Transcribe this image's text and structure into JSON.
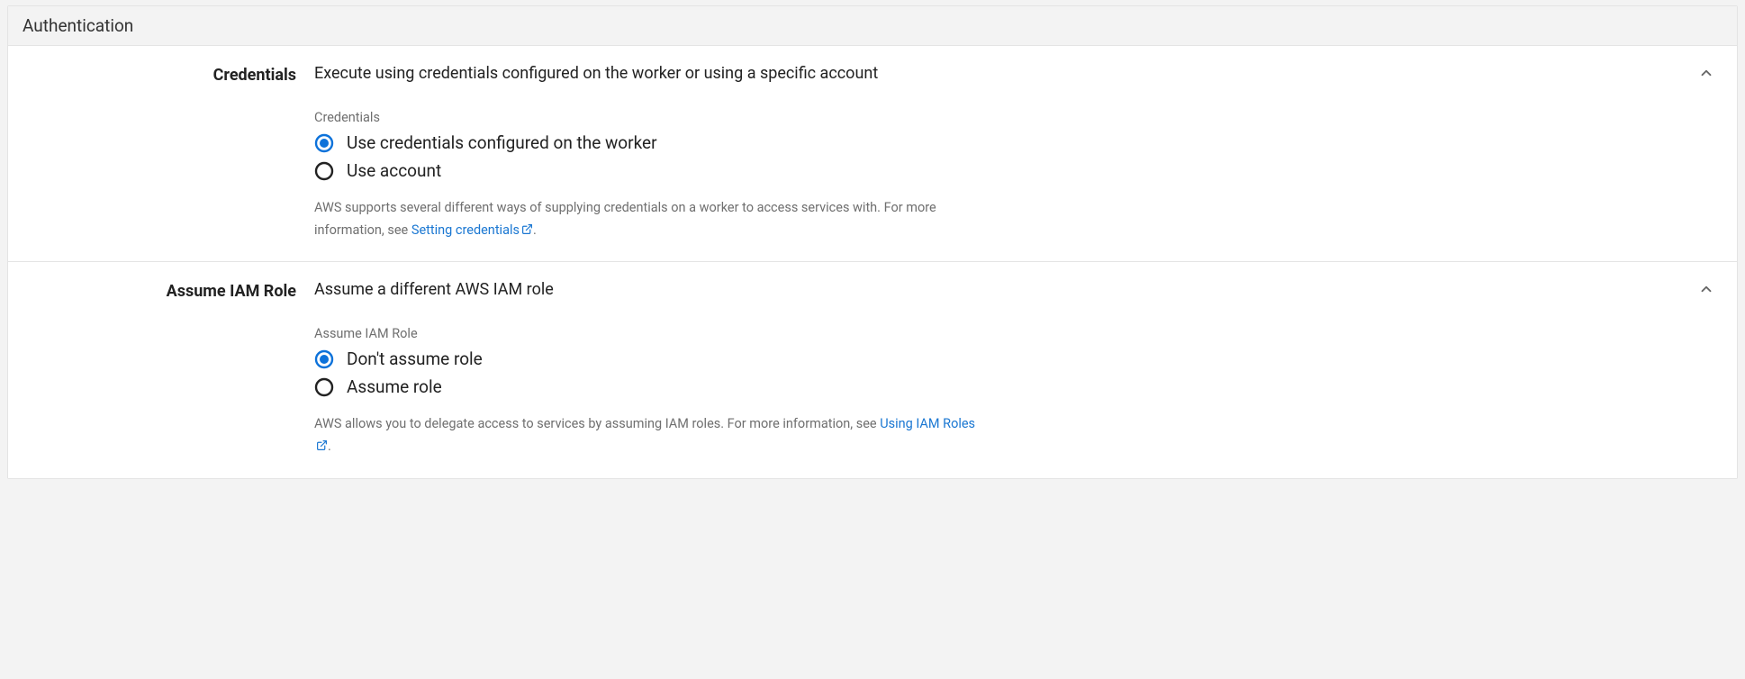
{
  "panel": {
    "title": "Authentication"
  },
  "credentials": {
    "title": "Credentials",
    "summary": "Execute using credentials configured on the worker or using a specific account",
    "field_label": "Credentials",
    "options": {
      "worker": "Use credentials configured on the worker",
      "account": "Use account"
    },
    "selected": "worker",
    "help_prefix": "AWS supports several different ways of supplying credentials on a worker to access services with. For more information, see ",
    "help_link": "Setting credentials",
    "help_suffix": "."
  },
  "assume_role": {
    "title": "Assume IAM Role",
    "summary": "Assume a different AWS IAM role",
    "field_label": "Assume IAM Role",
    "options": {
      "dont_assume": "Don't assume role",
      "assume": "Assume role"
    },
    "selected": "dont_assume",
    "help_prefix": "AWS allows you to delegate access to services by assuming IAM roles. For more information, see ",
    "help_link": "Using IAM Roles",
    "help_suffix": "."
  }
}
